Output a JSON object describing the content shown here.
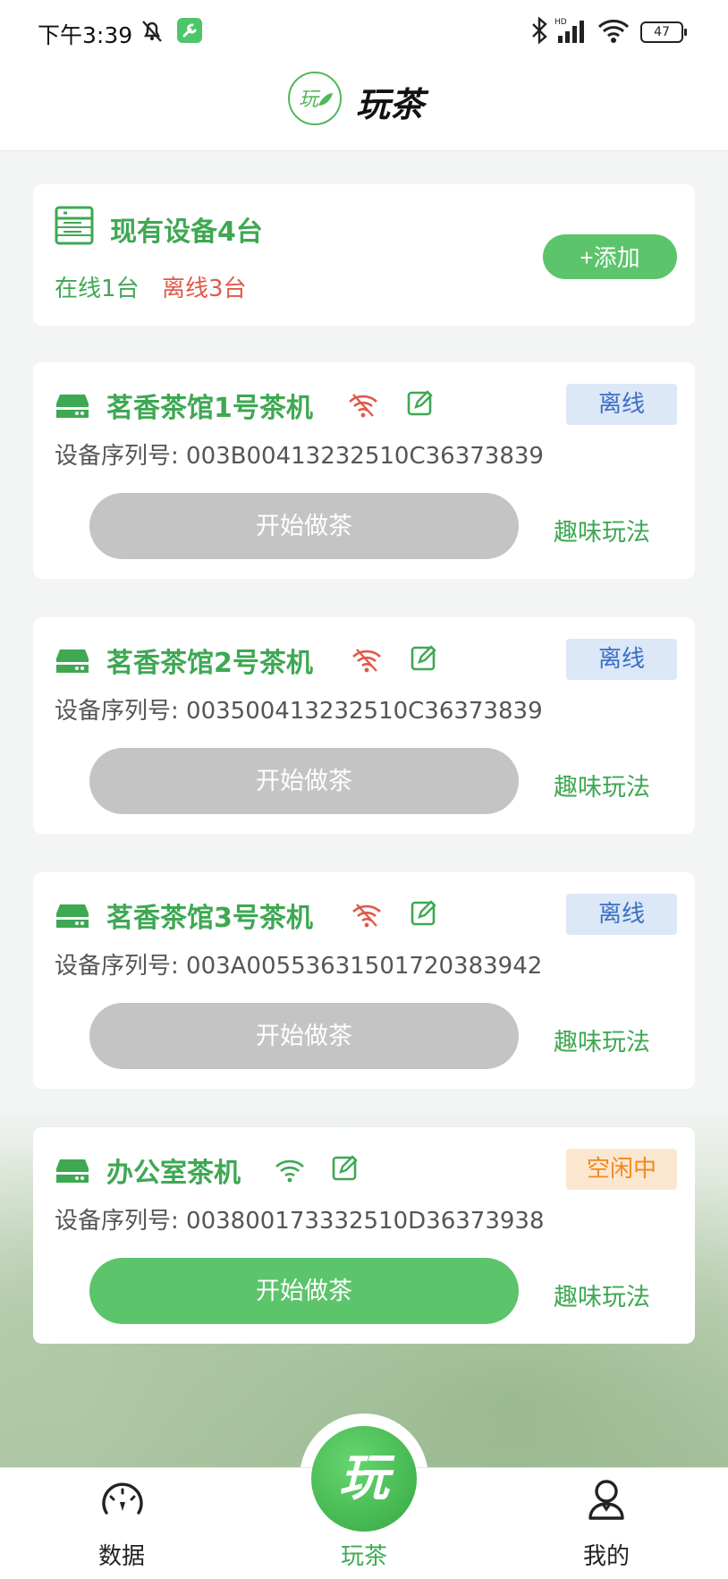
{
  "status_bar": {
    "time": "下午3:39",
    "battery": "47",
    "icons": [
      "mute-icon",
      "tool-app-icon",
      "bluetooth-icon",
      "signal-hd-icon",
      "wifi-icon",
      "battery-icon"
    ]
  },
  "header": {
    "logo_glyph": "玩",
    "title": "玩茶"
  },
  "summary": {
    "title": "现有设备4台",
    "online": "在线1台",
    "offline": "离线3台",
    "add_label": "+添加"
  },
  "devices": [
    {
      "name": "茗香茶馆1号茶机",
      "status": "离线",
      "serial": "设备序列号: 003B00413232510C36373839",
      "start_label": "开始做茶",
      "fun_label": "趣味玩法"
    },
    {
      "name": "茗香茶馆2号茶机",
      "status": "离线",
      "serial": "设备序列号: 003500413232510C36373839",
      "start_label": "开始做茶",
      "fun_label": "趣味玩法"
    },
    {
      "name": "茗香茶馆3号茶机",
      "status": "离线",
      "serial": "设备序列号: 003A00553631501720383942",
      "start_label": "开始做茶",
      "fun_label": "趣味玩法"
    },
    {
      "name": "办公室茶机",
      "status": "空闲中",
      "serial": "设备序列号: 003800173332510D36373938",
      "start_label": "开始做茶",
      "fun_label": "趣味玩法"
    }
  ],
  "tabs": [
    {
      "label": "数据",
      "icon": "dashboard-icon"
    },
    {
      "label": "玩茶",
      "icon": "play-tea-icon",
      "glyph": "玩"
    },
    {
      "label": "我的",
      "icon": "profile-icon"
    }
  ],
  "colors": {
    "brand_green": "#3ea853",
    "button_green": "#5cc46b",
    "offline_red": "#e0594a",
    "offline_badge_bg": "#dce7f7",
    "offline_badge_text": "#3a6fc4",
    "idle_badge_bg": "#fbe6cf",
    "idle_badge_text": "#f08a1c",
    "disabled_button": "#c4c4c4"
  }
}
